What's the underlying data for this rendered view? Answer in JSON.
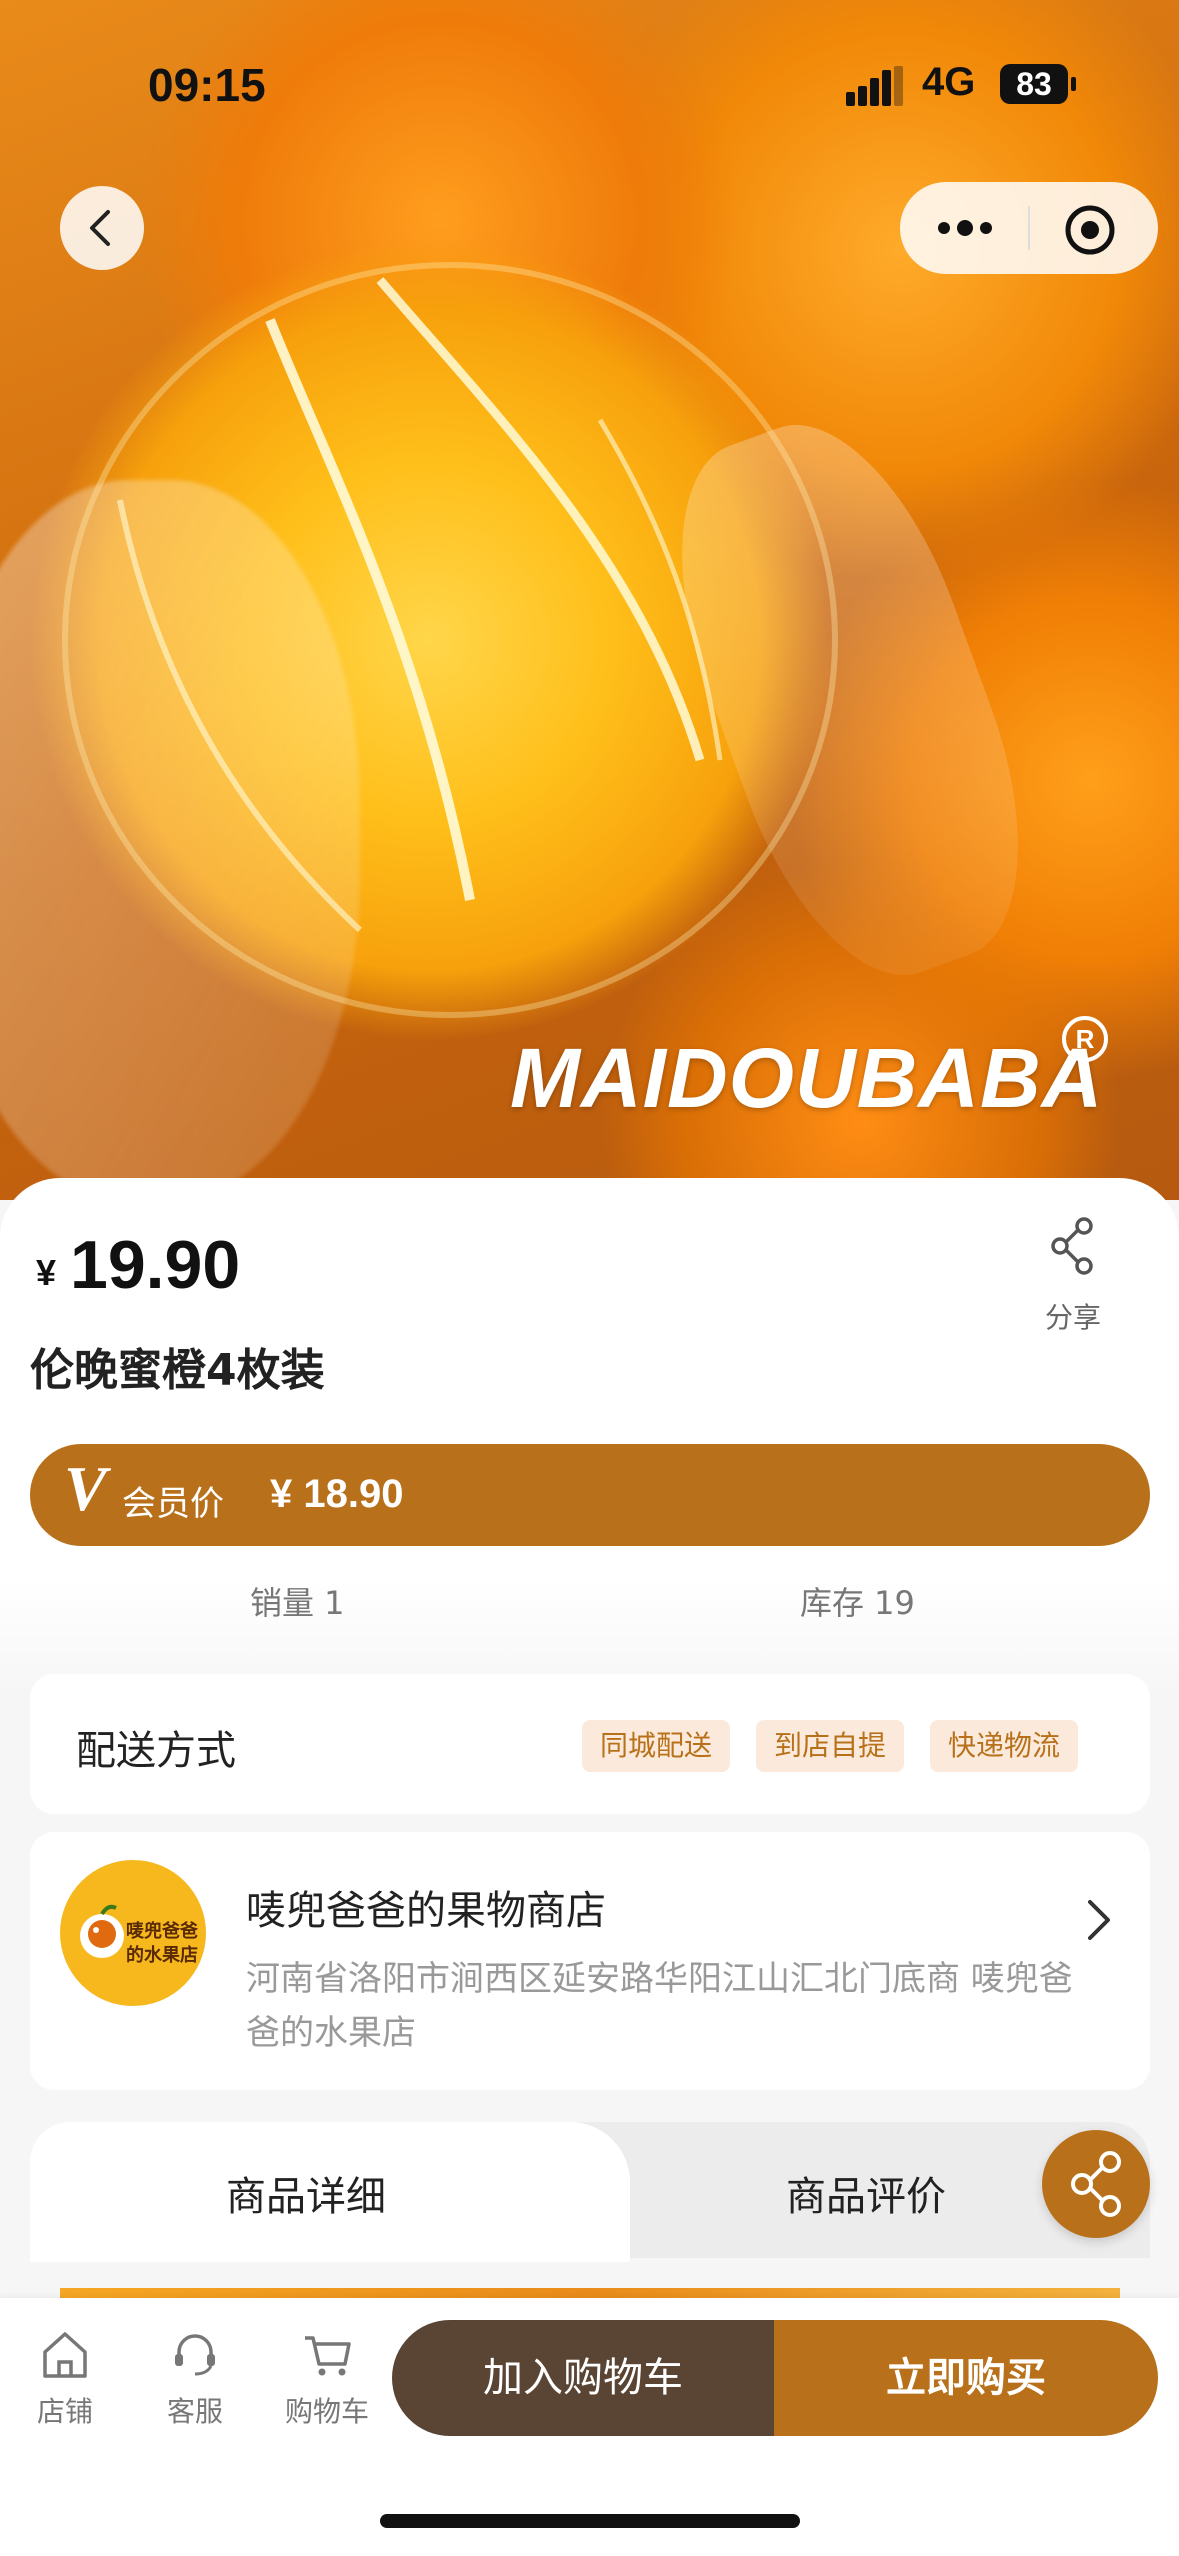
{
  "status_bar": {
    "time": "09:15",
    "network": "4G",
    "battery": "83"
  },
  "hero": {
    "brand_watermark": "MAIDOUBABA"
  },
  "product": {
    "currency": "¥",
    "price": "19.90",
    "title": "伦晚蜜橙4枚装",
    "share_label": "分享",
    "member_mark": "V",
    "member_label": "会员价",
    "member_price": "¥ 18.90",
    "sales": "销量 1",
    "stock": "库存 19"
  },
  "delivery": {
    "label": "配送方式",
    "options": [
      "同城配送",
      "到店自提",
      "快递物流"
    ]
  },
  "store": {
    "name": "唛兜爸爸的果物商店",
    "address": "河南省洛阳市涧西区延安路华阳江山汇北门底商 唛兜爸爸的水果店",
    "logo_text": [
      "唛兜爸爸",
      "的水果店"
    ]
  },
  "tabs": {
    "details": "商品详细",
    "reviews": "商品评价"
  },
  "bottom_bar": {
    "shop": "店铺",
    "service": "客服",
    "cart": "购物车",
    "add_to_cart": "加入购物车",
    "buy_now": "立即购买"
  },
  "colors": {
    "accent": "#b8711a",
    "dark_button": "#5a4535",
    "tag_bg": "#fbeadb"
  },
  "icons": [
    "back-chevron-icon",
    "more-dots-icon",
    "close-target-icon",
    "share-icon",
    "chevron-right-icon",
    "home-icon",
    "customer-service-icon",
    "cart-icon"
  ]
}
